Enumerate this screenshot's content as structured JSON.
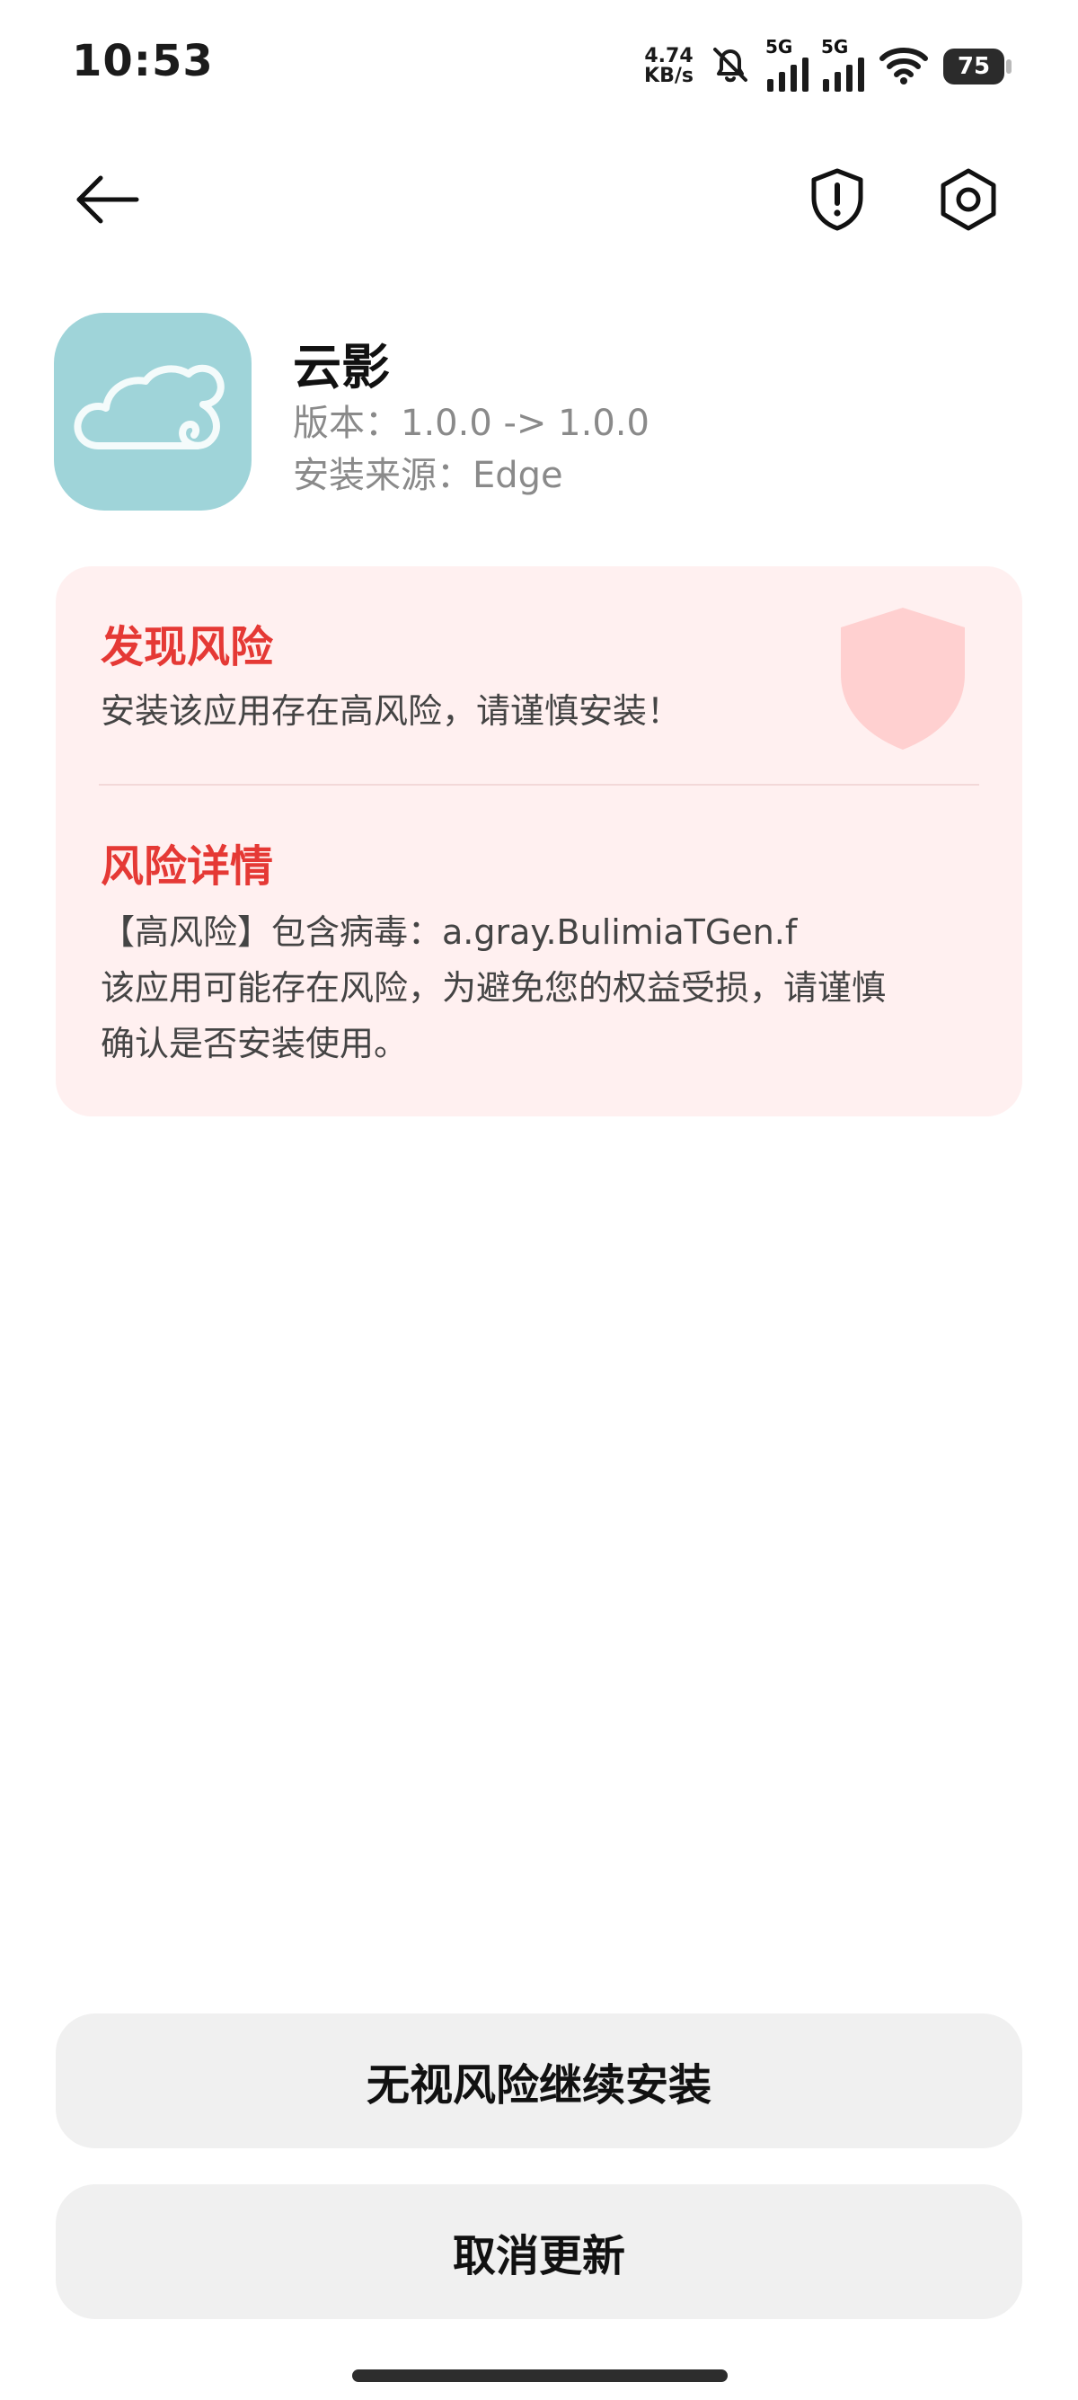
{
  "status_bar": {
    "time": "10:53",
    "net_speed_value": "4.74",
    "net_speed_unit": "KB/s",
    "signal1_label": "5G",
    "signal2_label": "5G",
    "battery": "75"
  },
  "app": {
    "name": "云影",
    "version": "版本：1.0.0 -> 1.0.0",
    "source": "安装来源：Edge"
  },
  "risk": {
    "title": "发现风险",
    "summary": "安装该应用存在高风险，请谨慎安装！",
    "details_title": "风险详情",
    "detail_line1": "【高风险】包含病毒：a.gray.BulimiaTGen.f",
    "detail_line2": "该应用可能存在风险，为避免您的权益受损，请谨慎",
    "detail_line3": "确认是否安装使用。"
  },
  "actions": {
    "continue_label": "无视风险继续安装",
    "cancel_label": "取消更新"
  },
  "colors": {
    "risk_red": "#e53935",
    "card_bg": "#fff0f0",
    "app_icon_bg": "#9fd4d9"
  },
  "icons": [
    "back-arrow-icon",
    "shield-alert-icon",
    "settings-icon",
    "cloud-logo-icon",
    "shield-watermark-icon",
    "mute-bell-icon",
    "wifi-icon"
  ]
}
